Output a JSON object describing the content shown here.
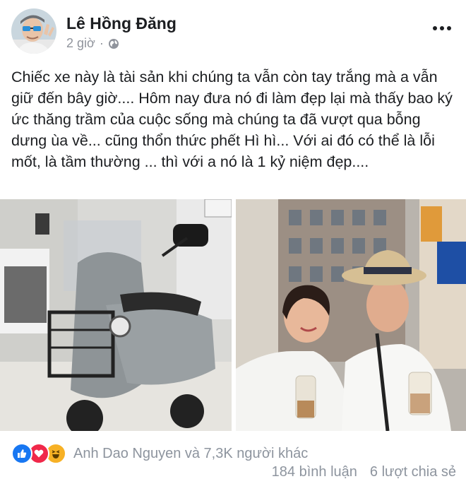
{
  "post": {
    "author_name": "Lê Hồng Đăng",
    "time": "2 giờ",
    "separator": "·",
    "privacy_icon": "globe-icon",
    "more_icon": "more-options-icon",
    "text": "Chiếc xe này là tài sản khi chúng ta vẫn còn tay trắng mà a vẫn giữ đến bây giờ.... Hôm nay đưa nó đi làm đẹp lại mà thấy bao ký ức thăng trầm của cuộc sống mà chúng ta đã vượt qua bỗng dưng ùa về... cũng thổn thức phết Hì hì... Với ai đó có thể là lỗi mốt, là tầm thường ... thì với a nó là 1 kỷ niệm đẹp....",
    "photos": [
      {
        "subject": "grey vintage scooter with windshield and front rack"
      },
      {
        "subject": "couple holding milk tea drinks on a city street"
      }
    ]
  },
  "engagement": {
    "reaction_icons": [
      "like-icon",
      "love-icon",
      "haha-icon"
    ],
    "reactions_text": "Anh Dao Nguyen và 7,3K người khác",
    "comments": "184 bình luận",
    "shares": "6 lượt chia sẻ"
  },
  "colors": {
    "primary_text": "#1c1e21",
    "secondary_text": "#90949c",
    "like_blue": "#1877f2",
    "love_red": "#f0284a",
    "haha_yellow": "#f7b125"
  }
}
